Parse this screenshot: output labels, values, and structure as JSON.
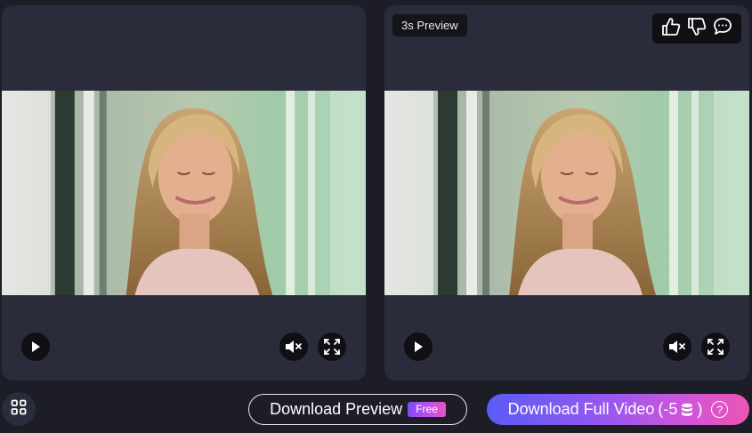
{
  "preview_panel": {
    "badge": "3s Preview"
  },
  "icons": {
    "play": "play-icon",
    "mute": "volume-mute-icon",
    "fullscreen": "fullscreen-icon",
    "thumbs_up": "thumbs-up-icon",
    "thumbs_down": "thumbs-down-icon",
    "comment": "comment-icon",
    "grid": "grid-icon",
    "coin": "coin-stack-icon",
    "help": "question-icon"
  },
  "footer": {
    "download_preview_label": "Download Preview",
    "free_tag": "Free",
    "download_full_label": "Download Full Video",
    "cost_prefix": "(-5",
    "cost_suffix": ")",
    "help_symbol": "?"
  },
  "colors": {
    "background": "#1c1d27",
    "panel": "#2b2c3b",
    "control_bg": "#0f0f14",
    "gradient_start": "#5a5cf5",
    "gradient_end": "#ec55b4"
  }
}
